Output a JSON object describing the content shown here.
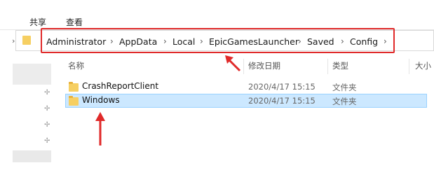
{
  "ribbon": {
    "tabs": [
      "共享",
      "查看"
    ]
  },
  "breadcrumb": {
    "items": [
      "Administrator",
      "AppData",
      "Local",
      "EpicGamesLauncher",
      "Saved",
      "Config"
    ],
    "separator": "›"
  },
  "columns": {
    "name": "名称",
    "modified": "修改日期",
    "type": "类型",
    "size": "大小"
  },
  "rows": [
    {
      "name": "CrashReportClient",
      "modified": "2020/4/17 15:15",
      "type": "文件夹"
    },
    {
      "name": "Windows",
      "modified": "2020/4/17 15:15",
      "type": "文件夹"
    }
  ],
  "colors": {
    "highlight_border": "#e02a2a",
    "arrow": "#e02a2a",
    "selected_row": "#cce8ff",
    "folder": "#f6cf62"
  },
  "icons": {
    "folder": "folder-icon",
    "pin": "pin-icon",
    "arrow": "red-arrow-icon"
  }
}
